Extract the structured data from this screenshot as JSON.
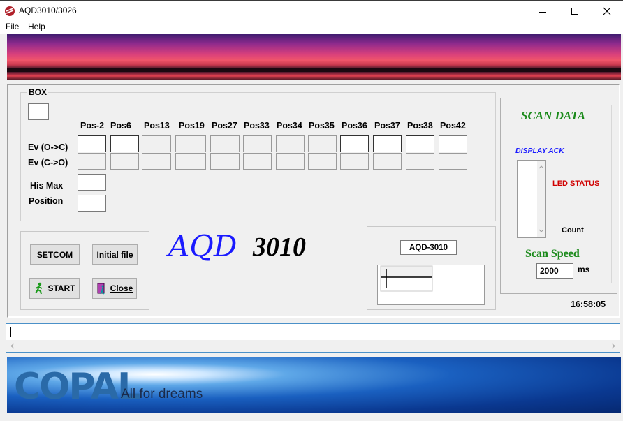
{
  "window": {
    "title": "AQD3010/3026"
  },
  "menu": {
    "file": "File",
    "help": "Help"
  },
  "box_group": {
    "label": "BOX"
  },
  "positions": [
    "Pos-2",
    "Pos6",
    "Pos13",
    "Pos19",
    "Pos27",
    "Pos33",
    "Pos34",
    "Pos35",
    "Pos36",
    "Pos37",
    "Pos38",
    "Pos42"
  ],
  "rows": {
    "ev_oc": "Ev (O->C)",
    "ev_co": "Ev (C->O)",
    "his_max": "His Max",
    "position": "Position"
  },
  "buttons": {
    "setcom": "SETCOM",
    "initial_file": "Initial file",
    "start": "START",
    "close": "Close"
  },
  "logo": {
    "aqd": "AQD",
    "number": "3010"
  },
  "device": {
    "badge": "AQD-3010"
  },
  "scan": {
    "title": "SCAN DATA",
    "display_ack": "DISPLAY ACK",
    "led_status": "LED STATUS",
    "count": "Count",
    "speed_label": "Scan Speed",
    "speed_value": "2000",
    "unit": "ms",
    "clock": "16:58:05"
  },
  "banner": {
    "brand": "COPAL",
    "tagline": "All for dreams"
  },
  "colors": {
    "accent_blue": "#1a1aff",
    "green": "#1a8a1a",
    "red": "#d00000"
  }
}
